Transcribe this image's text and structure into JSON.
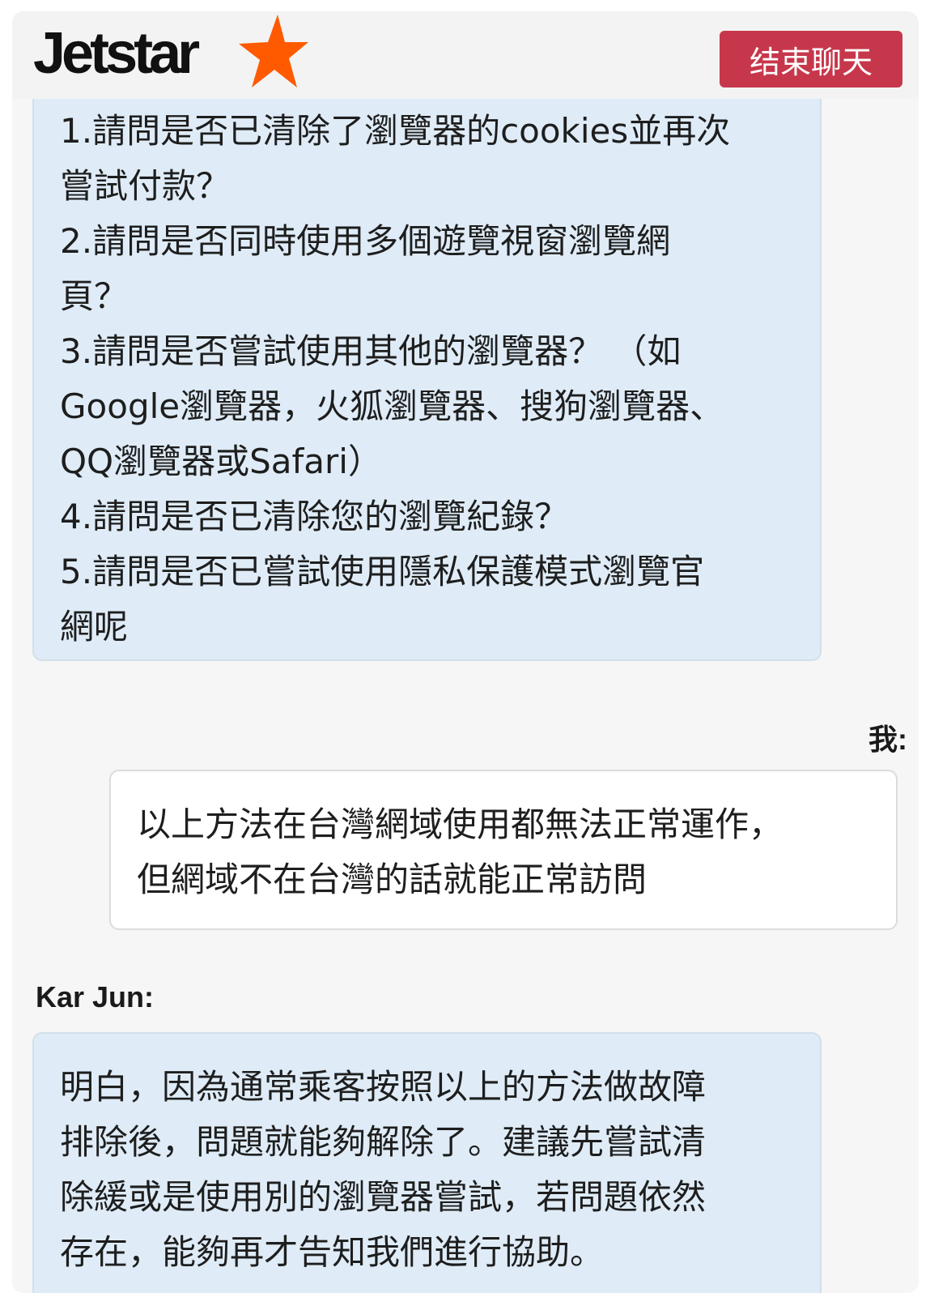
{
  "header": {
    "logo_text": "Jetstar",
    "end_chat_label": "结束聊天"
  },
  "colors": {
    "end_chat_bg": "#c7374b",
    "agent_bubble_bg": "#dfecf7",
    "user_bubble_bg": "#ffffff",
    "logo_star": "#ff5a00"
  },
  "messages": [
    {
      "sender": "",
      "lines": [
        "1.請問是否已清除了瀏覽器的cookies並再次",
        "嘗試付款？",
        "2.請問是否同時使用多個遊覽視窗瀏覽網",
        "頁？",
        "3.請問是否嘗試使用其他的瀏覽器？ （如",
        "Google瀏覽器，火狐瀏覽器、搜狗瀏覽器、",
        "QQ瀏覽器或Safari）",
        "4.請問是否已清除您的瀏覽紀錄？",
        "5.請問是否已嘗試使用隱私保護模式瀏覽官",
        "網呢"
      ]
    },
    {
      "sender": "我:",
      "lines": [
        "以上方法在台灣網域使用都無法正常運作，",
        "但網域不在台灣的話就能正常訪問"
      ]
    },
    {
      "sender": "Kar Jun:",
      "lines": [
        "明白，因為通常乘客按照以上的方法做故障",
        "排除後，問題就能夠解除了。建議先嘗試清",
        "除緩或是使用別的瀏覽器嘗試，若問題依然",
        "存在，能夠再才告知我們進行協助。"
      ]
    }
  ]
}
